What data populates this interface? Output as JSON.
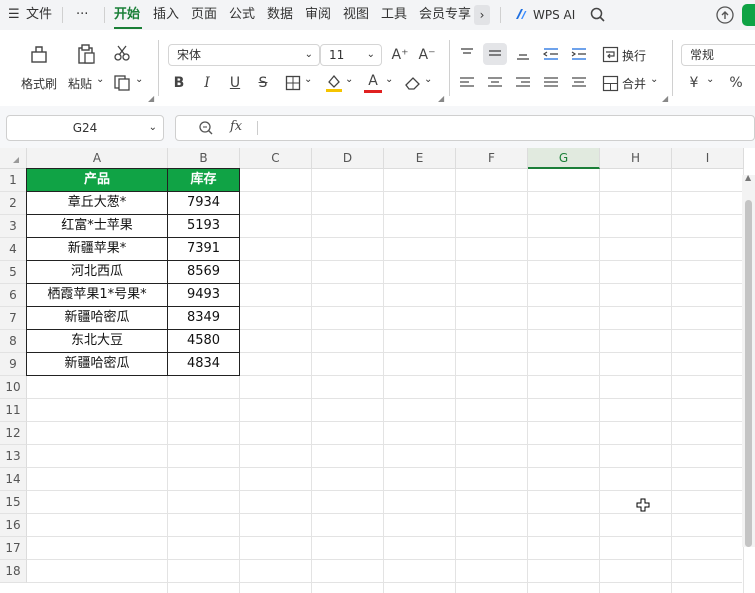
{
  "menubar": {
    "hamburger": "☰",
    "file_label": "文件",
    "more_label": "···",
    "tabs": [
      "开始",
      "插入",
      "页面",
      "公式",
      "数据",
      "审阅",
      "视图",
      "工具",
      "会员专享"
    ],
    "wps_ai_label": "WPS AI"
  },
  "ribbon": {
    "format_painter_label": "格式刷",
    "paste_label": "粘贴",
    "font_name": "宋体",
    "font_size": "11",
    "wrap_label": "换行",
    "merge_label": "合并",
    "number_format": "常规",
    "bold_glyph": "B",
    "italic_glyph": "I",
    "underline_glyph": "U",
    "strike_glyph": "S",
    "currency_glyph": "¥",
    "percent_glyph": "%",
    "grow_glyph": "A⁺",
    "shrink_glyph": "A⁻",
    "font_color_glyph": "A"
  },
  "formula_bar": {
    "cell_ref": "G24",
    "fx_label": "fx",
    "value": ""
  },
  "sheet": {
    "columns": [
      "A",
      "B",
      "C",
      "D",
      "E",
      "F",
      "G",
      "H",
      "I"
    ],
    "selected_column": "G",
    "rows": [
      "1",
      "2",
      "3",
      "4",
      "5",
      "6",
      "7",
      "8",
      "9",
      "10",
      "11",
      "12",
      "13",
      "14",
      "15",
      "16",
      "17",
      "18"
    ],
    "table": {
      "headers": [
        "产品",
        "库存"
      ],
      "header_color": "#10A345",
      "records": [
        [
          "章丘大葱*",
          "7934"
        ],
        [
          "红富*士苹果",
          "5193"
        ],
        [
          "新疆苹果*",
          "7391"
        ],
        [
          "河北西瓜",
          "8569"
        ],
        [
          "栖霞苹果1*号果*",
          "9493"
        ],
        [
          "新疆哈密瓜",
          "8349"
        ],
        [
          "东北大豆",
          "4580"
        ],
        [
          "新疆哈密瓜",
          "4834"
        ]
      ]
    }
  },
  "colors": {
    "accent": "#1A7F37"
  }
}
